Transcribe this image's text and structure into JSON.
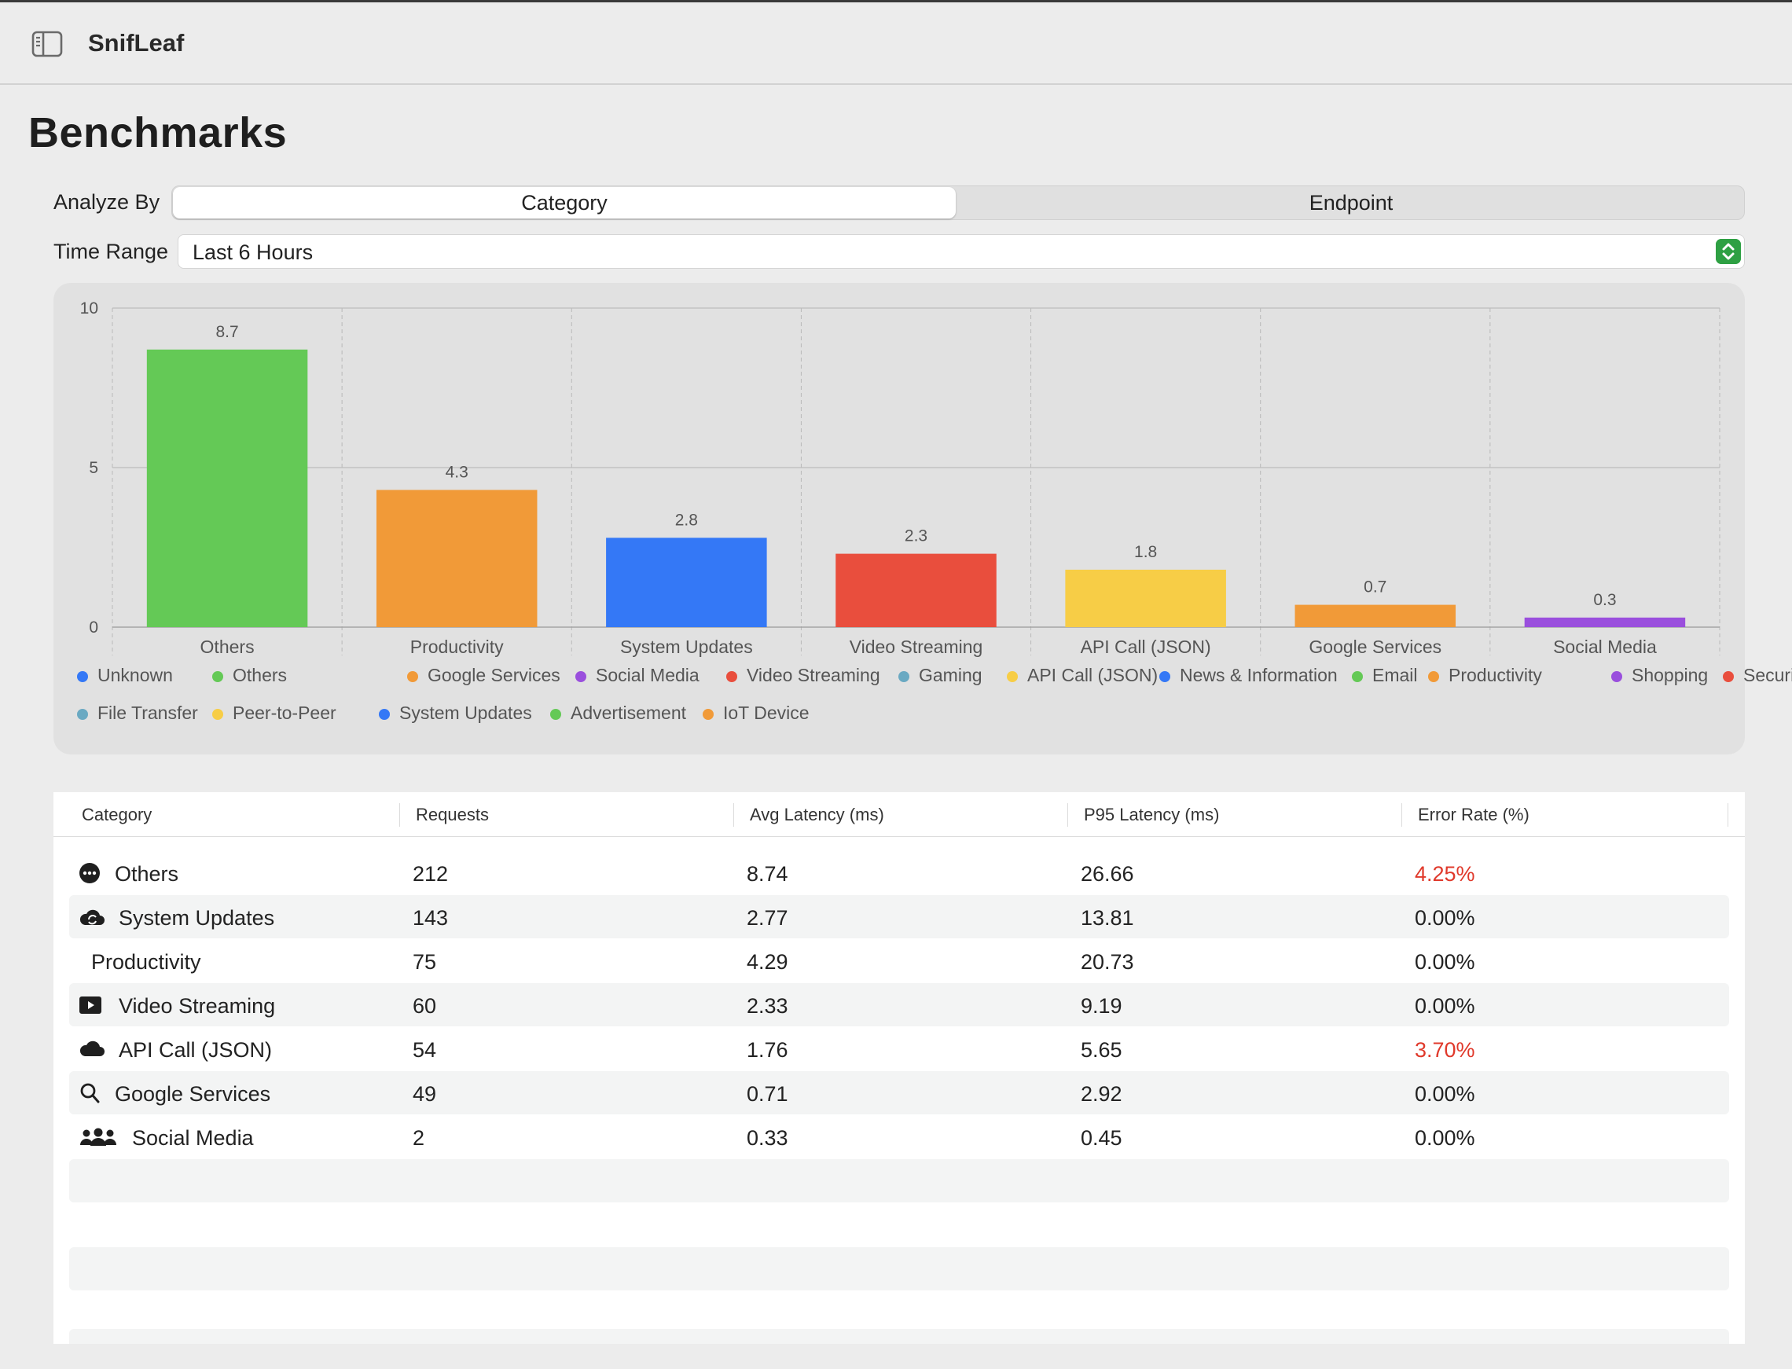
{
  "app": {
    "title": "SnifLeaf"
  },
  "page": {
    "title": "Benchmarks"
  },
  "analyze": {
    "label": "Analyze By",
    "options": [
      "Category",
      "Endpoint"
    ],
    "selected": "Category"
  },
  "time_range": {
    "label": "Time Range",
    "value": "Last 6 Hours"
  },
  "colors": {
    "green": "#64c956",
    "orange": "#f19a38",
    "blue": "#3478f6",
    "red": "#e94e3d",
    "yellow": "#f7cd46",
    "purple": "#9a4fdd",
    "teal": "#6aa9c2",
    "error_text": "#e0392b"
  },
  "chart_data": {
    "type": "bar",
    "categories": [
      "Others",
      "Productivity",
      "System Updates",
      "Video Streaming",
      "API Call (JSON)",
      "Google Services",
      "Social Media"
    ],
    "values": [
      8.7,
      4.3,
      2.8,
      2.3,
      1.8,
      0.7,
      0.3
    ],
    "value_labels": [
      "8.7",
      "4.3",
      "2.8",
      "2.3",
      "1.8",
      "0.7",
      "0.3"
    ],
    "bar_colors": [
      "#64c956",
      "#f19a38",
      "#3478f6",
      "#e94e3d",
      "#f7cd46",
      "#f19a38",
      "#9a4fdd"
    ],
    "ylim": [
      0,
      10
    ],
    "yticks": [
      "0",
      "5",
      "10"
    ],
    "grid": true,
    "legend_position": "bottom",
    "legend": [
      {
        "label": "Unknown",
        "color": "#3478f6"
      },
      {
        "label": "Others",
        "color": "#64c956"
      },
      {
        "label": "Google Services",
        "color": "#f19a38"
      },
      {
        "label": "Social Media",
        "color": "#9a4fdd"
      },
      {
        "label": "Video Streaming",
        "color": "#e94e3d"
      },
      {
        "label": "Gaming",
        "color": "#6aa9c2"
      },
      {
        "label": "API Call (JSON)",
        "color": "#f7cd46"
      },
      {
        "label": "News & Information",
        "color": "#3478f6"
      },
      {
        "label": "Email",
        "color": "#64c956"
      },
      {
        "label": "Productivity",
        "color": "#f19a38"
      },
      {
        "label": "Shopping",
        "color": "#9a4fdd"
      },
      {
        "label": "Security/VPN",
        "color": "#e94e3d"
      },
      {
        "label": "File Transfer",
        "color": "#6aa9c2"
      },
      {
        "label": "Peer-to-Peer",
        "color": "#f7cd46"
      },
      {
        "label": "System Updates",
        "color": "#3478f6"
      },
      {
        "label": "Advertisement",
        "color": "#64c956"
      },
      {
        "label": "IoT Device",
        "color": "#f19a38"
      }
    ]
  },
  "table": {
    "columns": [
      "Category",
      "Requests",
      "Avg Latency (ms)",
      "P95 Latency (ms)",
      "Error Rate (%)"
    ],
    "rows": [
      {
        "icon": "more-circle-icon",
        "category": "Others",
        "requests": "212",
        "avg": "8.74",
        "p95": "26.66",
        "error": "4.25%",
        "error_highlight": true
      },
      {
        "icon": "cloud-sync-icon",
        "category": "System Updates",
        "requests": "143",
        "avg": "2.77",
        "p95": "13.81",
        "error": "0.00%",
        "error_highlight": false
      },
      {
        "icon": "",
        "category": "Productivity",
        "requests": "75",
        "avg": "4.29",
        "p95": "20.73",
        "error": "0.00%",
        "error_highlight": false
      },
      {
        "icon": "play-rectangle-icon",
        "category": "Video Streaming",
        "requests": "60",
        "avg": "2.33",
        "p95": "9.19",
        "error": "0.00%",
        "error_highlight": false
      },
      {
        "icon": "cloud-icon",
        "category": "API Call (JSON)",
        "requests": "54",
        "avg": "1.76",
        "p95": "5.65",
        "error": "3.70%",
        "error_highlight": true
      },
      {
        "icon": "magnifying-glass-icon",
        "category": "Google Services",
        "requests": "49",
        "avg": "0.71",
        "p95": "2.92",
        "error": "0.00%",
        "error_highlight": false
      },
      {
        "icon": "people-group-icon",
        "category": "Social Media",
        "requests": "2",
        "avg": "0.33",
        "p95": "0.45",
        "error": "0.00%",
        "error_highlight": false
      }
    ]
  }
}
